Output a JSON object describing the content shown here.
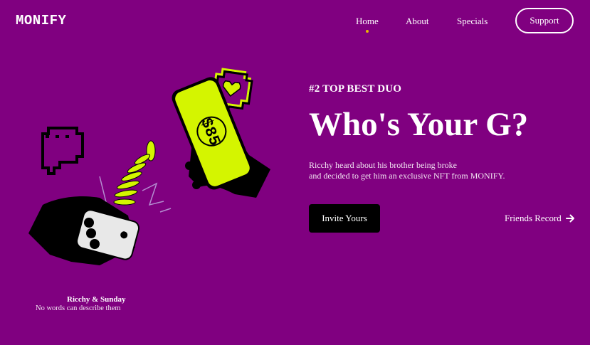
{
  "brand": {
    "logo": "MONIFY"
  },
  "nav": {
    "items": [
      {
        "label": "Home",
        "active": true
      },
      {
        "label": "About",
        "active": false
      },
      {
        "label": "Specials",
        "active": false
      }
    ],
    "support_label": "Support"
  },
  "hero": {
    "eyebrow": "#2 TOP BEST DUO",
    "title": "Who's Your G?",
    "description_lines": [
      "Ricchy heard about his brother being broke",
      "and decided to get him an exclusive NFT from MONIFY."
    ],
    "cta_label": "Invite Yours",
    "secondary_label": "Friends Record",
    "secondary_icon": "arrow-right-icon"
  },
  "illustration": {
    "phone_screen_text": "$85",
    "icons": [
      "chat-bubble-icon",
      "heart-bubble-icon",
      "phone-icon"
    ]
  },
  "caption": {
    "name": "Ricchy & Sunday",
    "subtitle": "No words can describe them"
  },
  "colors": {
    "background": "#800080",
    "accent_lime": "#d4f500",
    "active_dot": "#e8b800",
    "button_dark": "#000000"
  }
}
